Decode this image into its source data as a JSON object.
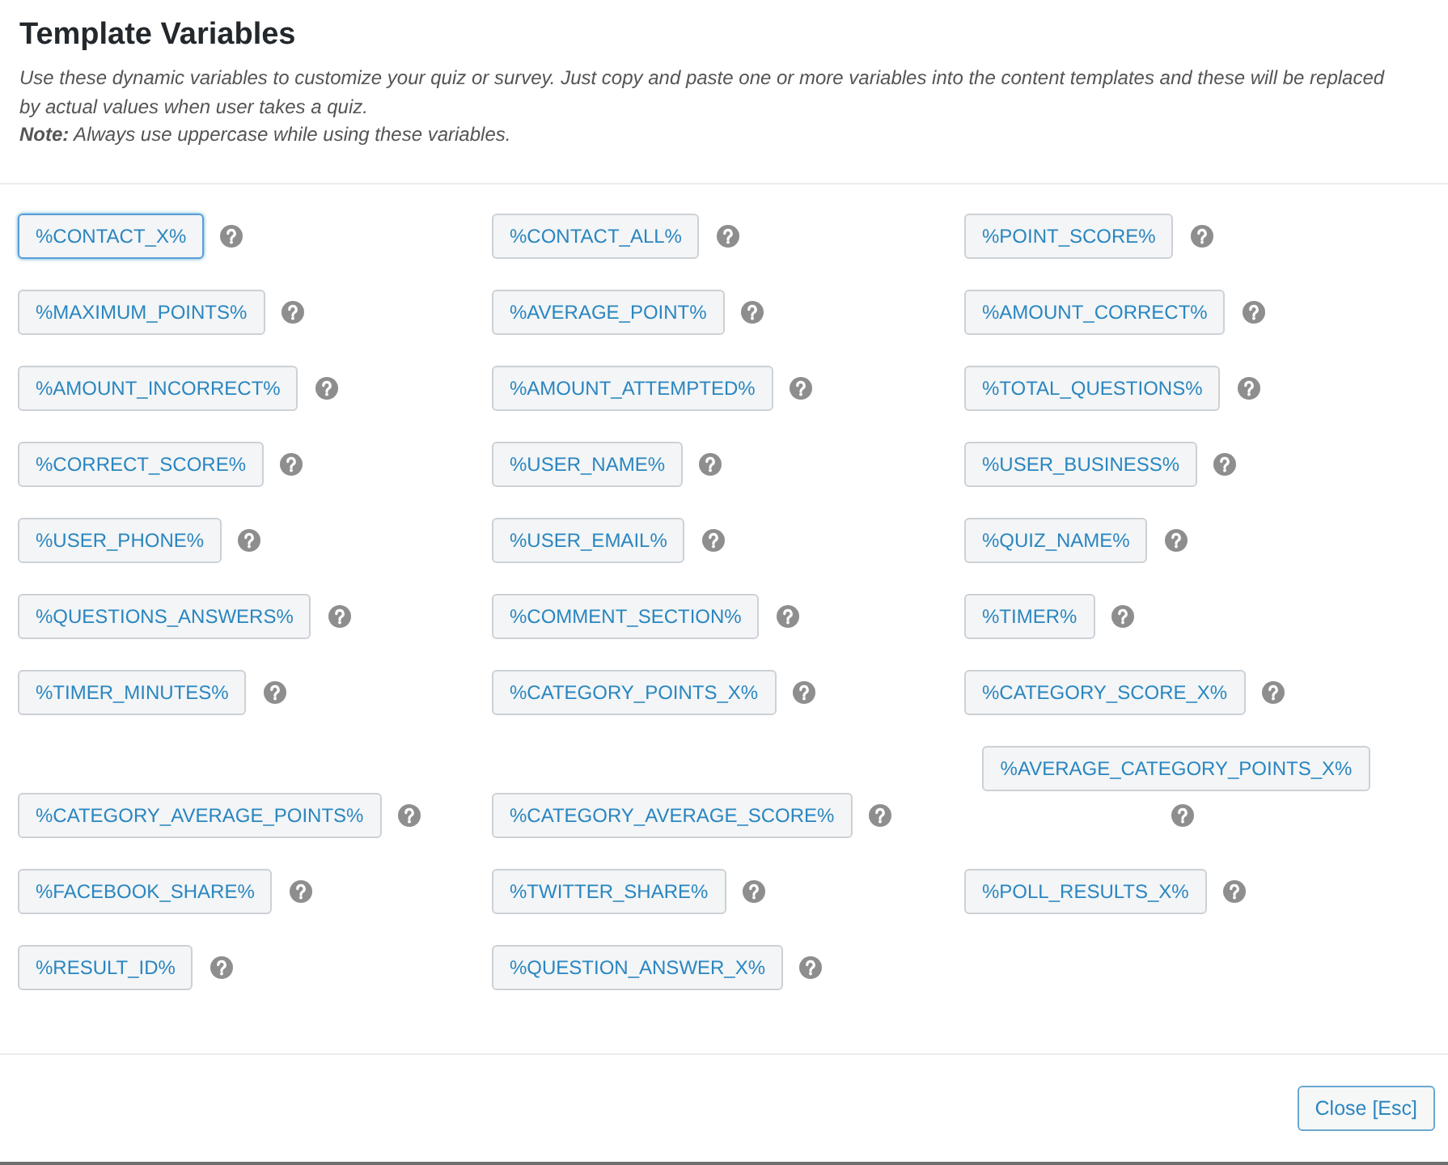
{
  "modal": {
    "title": "Template Variables",
    "description": "Use these dynamic variables to customize your quiz or survey. Just copy and paste one or more variables into the content templates and these will be replaced by actual values when user takes a quiz.",
    "note": "**Note:** Always use uppercase while using these variables."
  },
  "variables": [
    {
      "label": "%CONTACT_X%",
      "focused": true
    },
    {
      "label": "%CONTACT_ALL%",
      "focused": false
    },
    {
      "label": "%POINT_SCORE%",
      "focused": false
    },
    {
      "label": "%MAXIMUM_POINTS%",
      "focused": false
    },
    {
      "label": "%AVERAGE_POINT%",
      "focused": false
    },
    {
      "label": "%AMOUNT_CORRECT%",
      "focused": false
    },
    {
      "label": "%AMOUNT_INCORRECT%",
      "focused": false
    },
    {
      "label": "%AMOUNT_ATTEMPTED%",
      "focused": false
    },
    {
      "label": "%TOTAL_QUESTIONS%",
      "focused": false
    },
    {
      "label": "%CORRECT_SCORE%",
      "focused": false
    },
    {
      "label": "%USER_NAME%",
      "focused": false
    },
    {
      "label": "%USER_BUSINESS%",
      "focused": false
    },
    {
      "label": "%USER_PHONE%",
      "focused": false
    },
    {
      "label": "%USER_EMAIL%",
      "focused": false
    },
    {
      "label": "%QUIZ_NAME%",
      "focused": false
    },
    {
      "label": "%QUESTIONS_ANSWERS%",
      "focused": false
    },
    {
      "label": "%COMMENT_SECTION%",
      "focused": false
    },
    {
      "label": "%TIMER%",
      "focused": false
    },
    {
      "label": "%TIMER_MINUTES%",
      "focused": false
    },
    {
      "label": "%CATEGORY_POINTS_X%",
      "focused": false
    },
    {
      "label": "%CATEGORY_SCORE_X%",
      "focused": false
    },
    {
      "label": "%CATEGORY_AVERAGE_POINTS%",
      "focused": false
    },
    {
      "label": "%CATEGORY_AVERAGE_SCORE%",
      "focused": false
    },
    {
      "label": "%AVERAGE_CATEGORY_POINTS_X%",
      "focused": false
    },
    {
      "label": "%FACEBOOK_SHARE%",
      "focused": false
    },
    {
      "label": "%TWITTER_SHARE%",
      "focused": false
    },
    {
      "label": "%POLL_RESULTS_X%",
      "focused": false
    },
    {
      "label": "%RESULT_ID%",
      "focused": false
    },
    {
      "label": "%QUESTION_ANSWER_X%",
      "focused": false
    }
  ],
  "footer": {
    "close_button": "Close [Esc]"
  }
}
